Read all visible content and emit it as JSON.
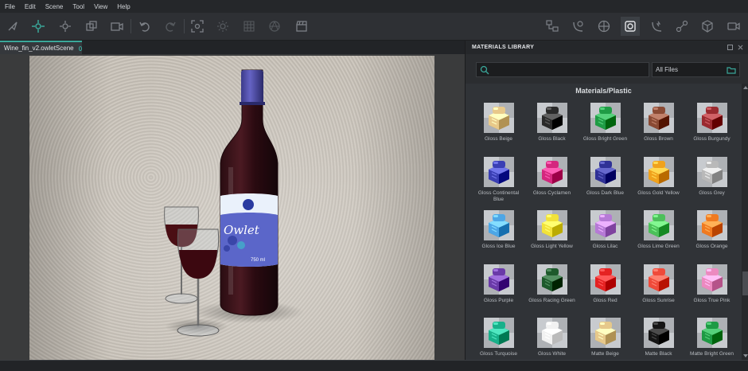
{
  "menu": [
    "File",
    "Edit",
    "Scene",
    "Tool",
    "View",
    "Help"
  ],
  "toolbar": {
    "left_icons": [
      "select-icon",
      "move-icon",
      "orbit-icon",
      "transform-icon",
      "camera-icon",
      "undo-icon",
      "redo-icon",
      "focus-icon",
      "sun-icon",
      "grid-icon",
      "sphere-icon",
      "clapperboard-icon"
    ],
    "right_icons": [
      "hierarchy-icon",
      "material-icon",
      "environment-icon",
      "material-library-icon",
      "lighting-icon",
      "gizmo-icon",
      "object-icon",
      "video-camera-icon"
    ]
  },
  "document": {
    "tab_label": "Wine_fin_v2.owletScene"
  },
  "bottle_label": {
    "brand": "Owlet",
    "volume": "750 ml"
  },
  "panel": {
    "title": "MATERIALS LIBRARY",
    "search_placeholder": "",
    "filter_value": "All Files",
    "category_title": "Materials/Plastic"
  },
  "materials": [
    {
      "label": "Gloss Beige",
      "color": "#e8c98a"
    },
    {
      "label": "Gloss Black",
      "color": "#2a2a2a"
    },
    {
      "label": "Gloss Bright Green",
      "color": "#1f9c45"
    },
    {
      "label": "Gloss Brown",
      "color": "#8a4a34"
    },
    {
      "label": "Gloss Burgundy",
      "color": "#9a2a2f"
    },
    {
      "label": "Gloss Continental Blue",
      "color": "#3a3fb4"
    },
    {
      "label": "Gloss Cyclamen",
      "color": "#d4277e"
    },
    {
      "label": "Gloss Dark Blue",
      "color": "#2f3196"
    },
    {
      "label": "Gloss Gold Yellow",
      "color": "#f0a21c"
    },
    {
      "label": "Gloss Grey",
      "color": "#b9b9b9"
    },
    {
      "label": "Gloss Ice Blue",
      "color": "#4da6e6"
    },
    {
      "label": "Gloss Light Yellow",
      "color": "#f2e23a"
    },
    {
      "label": "Gloss Lilac",
      "color": "#b67ad6"
    },
    {
      "label": "Gloss Lime Green",
      "color": "#4cc05a"
    },
    {
      "label": "Gloss Orange",
      "color": "#f07a20"
    },
    {
      "label": "Gloss Purple",
      "color": "#6a3aa8"
    },
    {
      "label": "Gloss Racing Green",
      "color": "#1e5a2c"
    },
    {
      "label": "Gloss Red",
      "color": "#e52222"
    },
    {
      "label": "Gloss Sunrise",
      "color": "#ef4a3a"
    },
    {
      "label": "Gloss True Pink",
      "color": "#ec8ac0"
    },
    {
      "label": "Gloss Turquoise",
      "color": "#19b08a"
    },
    {
      "label": "Gloss White",
      "color": "#f2f2f2"
    },
    {
      "label": "Matte Beige",
      "color": "#e6c88a"
    },
    {
      "label": "Matte Black",
      "color": "#151515"
    },
    {
      "label": "Matte Bright Green",
      "color": "#1e9a44"
    }
  ]
}
